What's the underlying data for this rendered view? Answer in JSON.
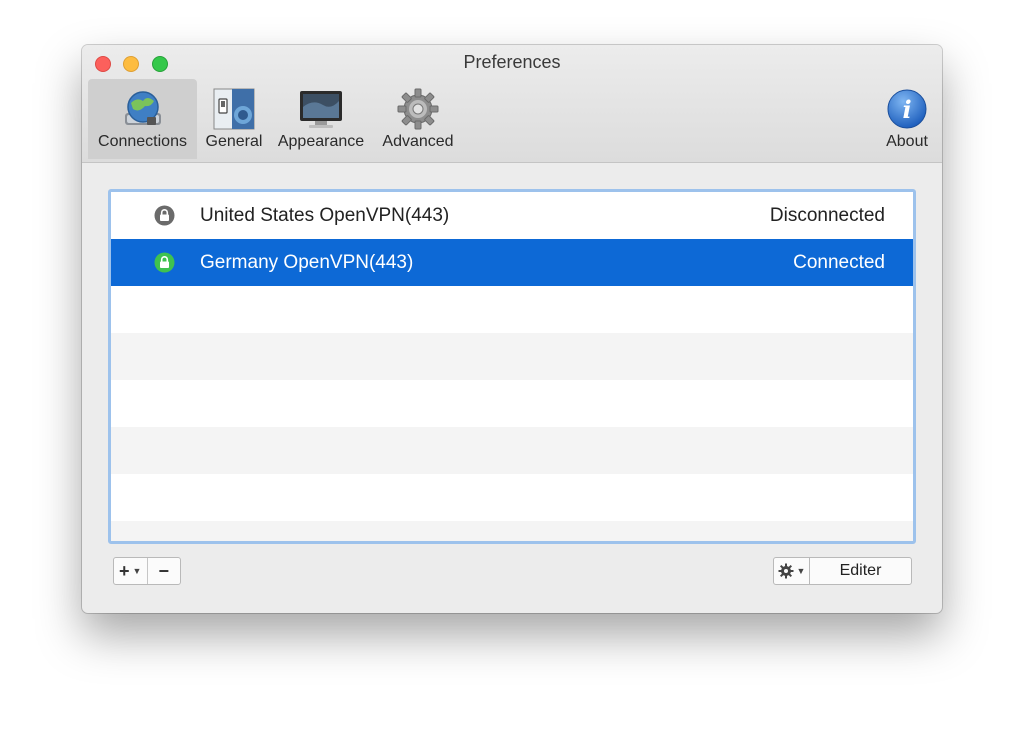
{
  "window": {
    "title": "Preferences"
  },
  "toolbar": {
    "tabs": [
      {
        "label": "Connections",
        "icon": "network-globe-icon",
        "selected": true
      },
      {
        "label": "General",
        "icon": "switch-panel-icon"
      },
      {
        "label": "Appearance",
        "icon": "monitor-icon"
      },
      {
        "label": "Advanced",
        "icon": "gear-icon"
      }
    ],
    "about": {
      "label": "About",
      "icon": "info-icon"
    }
  },
  "connections": [
    {
      "name": "United States OpenVPN(443)",
      "status": "Disconnected",
      "lock": "gray-lock-icon",
      "selected": false
    },
    {
      "name": "Germany OpenVPN(443)",
      "status": "Connected",
      "lock": "green-lock-icon",
      "selected": true
    }
  ],
  "footer": {
    "add_label": "+",
    "remove_label": "−",
    "edit_label": "Editer"
  },
  "colors": {
    "selection": "#0d69d6",
    "connected_lock": "#3fc24f",
    "disconnected_lock": "#6b6b6b",
    "focus_ring": "#9dc2ec"
  }
}
